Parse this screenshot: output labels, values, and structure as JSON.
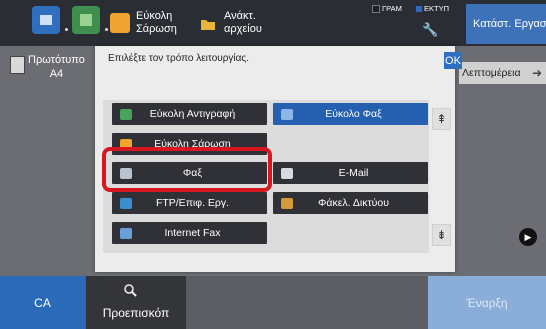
{
  "topbar": {
    "shortcuts": [
      {
        "label": "Εύκολη Σάρωση",
        "icon": "easy-scan-icon",
        "color": "#f0a330"
      },
      {
        "label": "Ανάκτ. αρχείου",
        "icon": "folder-icon",
        "color": "#e8b53a"
      }
    ],
    "status_items": [
      {
        "label": "ΓΡΑΜ",
        "color": "#1f2125"
      },
      {
        "label": "ΕΚΤΥΠ",
        "color": "#2f68c2"
      }
    ],
    "job_status_button": "Κατάστ. Εργασ"
  },
  "background": {
    "original_label": "Πρωτότυπο",
    "original_size": "A4",
    "details_button": "Λεπτομέρεια"
  },
  "dialog": {
    "title": "Επιλέξτε τον τρόπο λειτουργίας.",
    "ok_label": "OK",
    "modes": {
      "easy_copy": "Εύκολη Αντιγραφή",
      "easy_fax": "Εύκολο Φαξ",
      "easy_scan": "Εύκολη Σάρωση",
      "fax": "Φαξ",
      "email": "E-Mail",
      "ftp": "FTP/Επιφ. Εργ.",
      "network_folder": "Φάκελ. Δικτύου",
      "internet_fax": "Internet Fax"
    }
  },
  "bottombar": {
    "ca_label": "CA",
    "preview_label": "Προεπισκόπ",
    "start_label": "Έναρξη"
  },
  "colors": {
    "accent_blue": "#2f6fc0",
    "highlight_red": "#d6171f"
  }
}
